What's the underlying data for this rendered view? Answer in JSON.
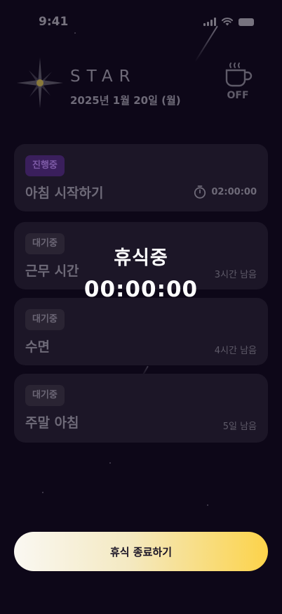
{
  "status_bar": {
    "time": "9:41"
  },
  "header": {
    "app_title": "STAR",
    "date": "2025년 1월 20일 (월)",
    "coffee_toggle_label": "OFF"
  },
  "tasks": [
    {
      "badge": "진행중",
      "title": "아침 시작하기",
      "meta": "02:00:00",
      "status": "active"
    },
    {
      "badge": "대기중",
      "title": "근무 시간",
      "meta": "3시간 남음",
      "status": "waiting"
    },
    {
      "badge": "대기중",
      "title": "수면",
      "meta": "4시간 남음",
      "status": "waiting"
    },
    {
      "badge": "대기중",
      "title": "주말 아침",
      "meta": "5일 남음",
      "status": "waiting"
    }
  ],
  "rest_overlay": {
    "label": "휴식중",
    "timer": "00:00:00"
  },
  "end_button_label": "휴식 종료하기",
  "icons": {
    "logo": "star-icon",
    "coffee": "coffee-cup-icon",
    "timer": "stopwatch-icon"
  },
  "colors": {
    "background": "#0d0718",
    "card": "#1c1627",
    "active_badge": "#3a1f5c",
    "button_accent": "#fcd34a"
  }
}
